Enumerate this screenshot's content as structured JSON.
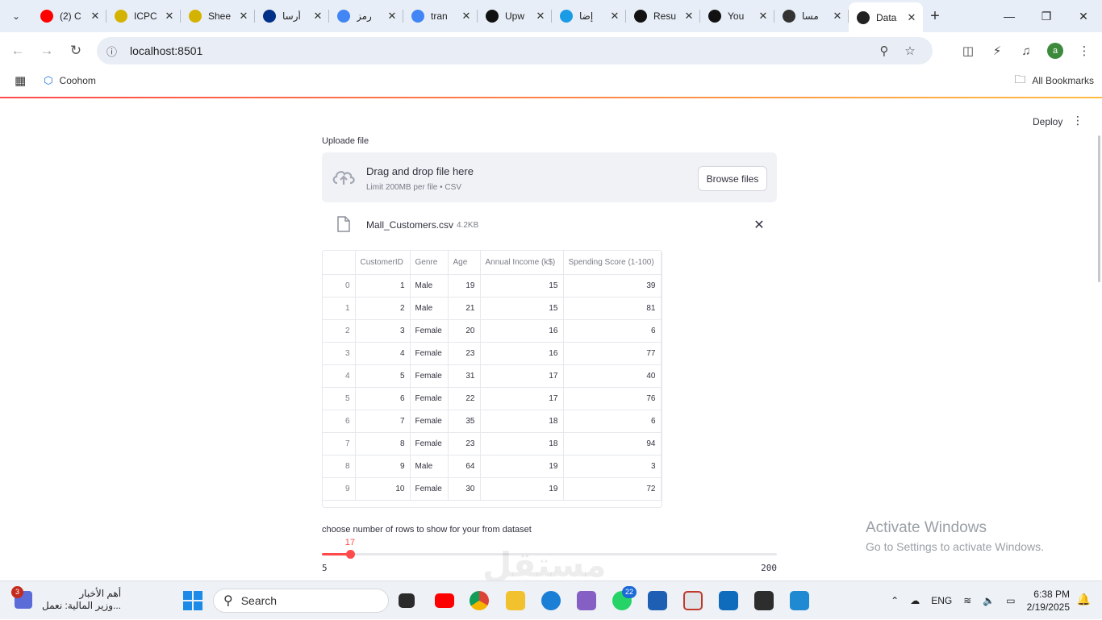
{
  "browser": {
    "tabs": [
      {
        "label": "(2) C",
        "color": "#ff0000"
      },
      {
        "label": "ICPC",
        "color": "#d4b300"
      },
      {
        "label": "Shee",
        "color": "#d4b300"
      },
      {
        "label": "أرسا",
        "color": "#003087"
      },
      {
        "label": "رمز",
        "color": "#4285f4"
      },
      {
        "label": "tran",
        "color": "#4285f4"
      },
      {
        "label": "Upw",
        "color": "#111111"
      },
      {
        "label": "إضا",
        "color": "#1a9be6"
      },
      {
        "label": "Resu",
        "color": "#111111"
      },
      {
        "label": "You",
        "color": "#111111"
      },
      {
        "label": "مسا",
        "color": "#333333"
      },
      {
        "label": "Data",
        "color": "#222222"
      }
    ],
    "url": "localhost:8501",
    "bookmark": "Coohom",
    "all_bookmarks": "All Bookmarks",
    "avatar_letter": "a"
  },
  "app": {
    "deploy": "Deploy",
    "uploader": {
      "label": "Uploade file",
      "title": "Drag and drop file here",
      "subtitle": "Limit 200MB per file • CSV",
      "browse": "Browse files",
      "file_name": "Mall_Customers.csv",
      "file_size": "4.2KB"
    },
    "table": {
      "columns": [
        "CustomerID",
        "Genre",
        "Age",
        "Annual Income (k$)",
        "Spending Score (1-100)"
      ],
      "rows": [
        [
          "0",
          "1",
          "Male",
          "19",
          "15",
          "39"
        ],
        [
          "1",
          "2",
          "Male",
          "21",
          "15",
          "81"
        ],
        [
          "2",
          "3",
          "Female",
          "20",
          "16",
          "6"
        ],
        [
          "3",
          "4",
          "Female",
          "23",
          "16",
          "77"
        ],
        [
          "4",
          "5",
          "Female",
          "31",
          "17",
          "40"
        ],
        [
          "5",
          "6",
          "Female",
          "22",
          "17",
          "76"
        ],
        [
          "6",
          "7",
          "Female",
          "35",
          "18",
          "6"
        ],
        [
          "7",
          "8",
          "Female",
          "23",
          "18",
          "94"
        ],
        [
          "8",
          "9",
          "Male",
          "64",
          "19",
          "3"
        ],
        [
          "9",
          "10",
          "Female",
          "30",
          "19",
          "72"
        ]
      ]
    },
    "slider": {
      "label": "choose number of rows to show for your from dataset",
      "value": 17,
      "min": 5,
      "max": 200
    }
  },
  "overlay": {
    "activate_title": "Activate Windows",
    "activate_sub": "Go to Settings to activate Windows.",
    "watermark": "مستقل"
  },
  "taskbar": {
    "news_badge": "3",
    "news_title": "أهم الأخبار",
    "news_sub": "وزير المالية: نعمل...",
    "search": "Search",
    "whatsapp_badge": "22",
    "lang": "ENG",
    "time": "6:38 PM",
    "date": "2/19/2025"
  }
}
